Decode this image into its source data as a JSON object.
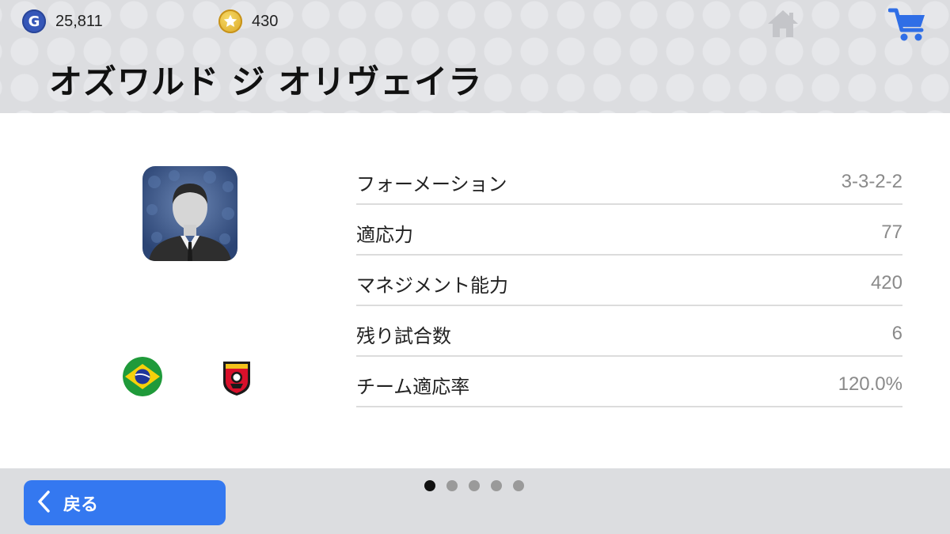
{
  "currency": {
    "gp_icon_letter": "G",
    "gp_amount": "25,811",
    "coins_amount": "430"
  },
  "icons": {
    "gp": "gp-icon",
    "coin": "star-coin-icon",
    "home": "home-icon",
    "cart": "shopping-cart-icon",
    "back": "chevron-left-icon"
  },
  "manager": {
    "name": "オズワルド ジ オリヴェイラ"
  },
  "stats": [
    {
      "label": "フォーメーション",
      "value": "3-3-2-2"
    },
    {
      "label": "適応力",
      "value": "77"
    },
    {
      "label": "マネジメント能力",
      "value": "420"
    },
    {
      "label": "残り試合数",
      "value": "6"
    },
    {
      "label": "チーム適応率",
      "value": "120.0%"
    }
  ],
  "footer": {
    "back_label": "戻る",
    "page_total": 5,
    "page_current": 1
  },
  "colors": {
    "accent": "#3478f0",
    "header_bg": "#dcdde0",
    "cart": "#2f6ee6",
    "gp": "#3657b8",
    "coin": "#e0b02c"
  }
}
